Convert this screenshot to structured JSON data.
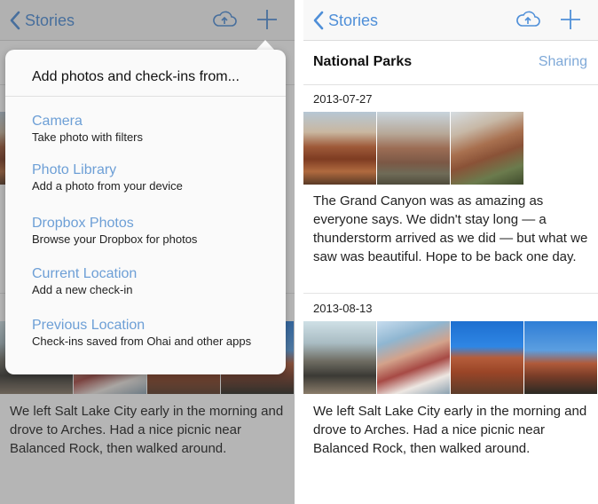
{
  "nav": {
    "back_label": "Stories"
  },
  "story": {
    "title": "National Parks",
    "sharing_label": "Sharing"
  },
  "entries": [
    {
      "date": "2013-07-27",
      "text": "The Grand Canyon was as amazing as everyone says. We didn't stay long — a thunderstorm arrived as we did — but what we saw was beautiful. Hope to be back one day."
    },
    {
      "date": "2013-08-13",
      "text": "We left Salt Lake City early in the morning and drove to Arches. Had a nice picnic near Balanced Rock, then walked around."
    }
  ],
  "popover": {
    "title": "Add photos and check-ins from...",
    "options": [
      {
        "title": "Camera",
        "subtitle": "Take photo with filters"
      },
      {
        "title": "Photo Library",
        "subtitle": "Add a photo from your device"
      },
      {
        "title": "Dropbox Photos",
        "subtitle": "Browse your Dropbox for photos"
      },
      {
        "title": "Current Location",
        "subtitle": "Add a new check-in"
      },
      {
        "title": "Previous Location",
        "subtitle": "Check-ins saved from Ohai and other apps"
      }
    ]
  },
  "icons": {
    "back": "chevron-left-icon",
    "upload": "cloud-upload-icon",
    "add": "plus-icon"
  },
  "colors": {
    "accent": "#4f8fd8",
    "sharing": "#7fa9d8",
    "option": "#6d9fd6",
    "dim_overlay": "rgba(60,60,60,0.38)"
  }
}
